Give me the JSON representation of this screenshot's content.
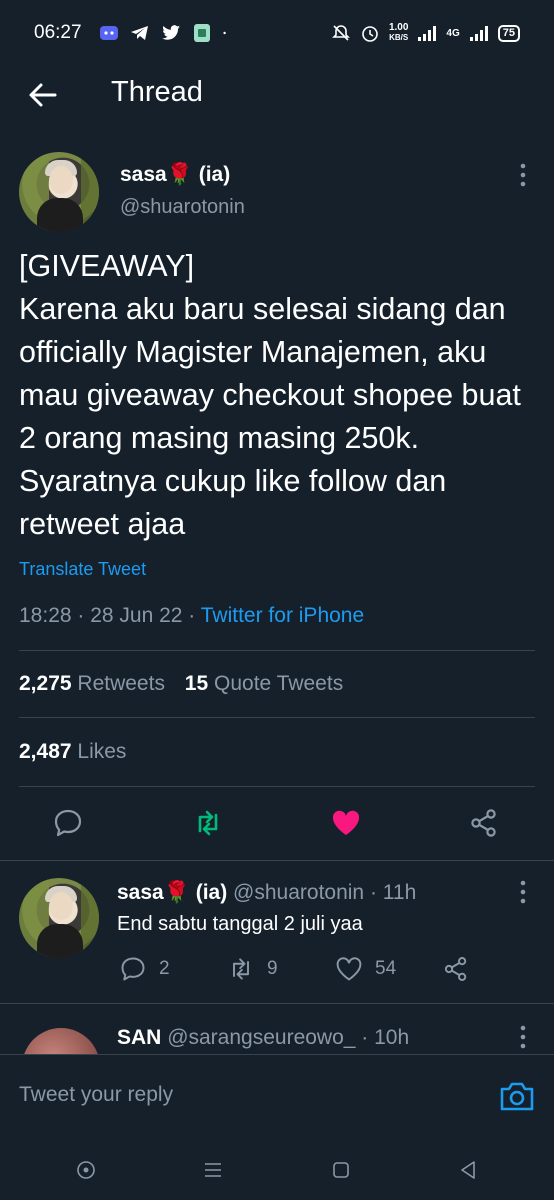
{
  "status_bar": {
    "time": "06:27",
    "speed_value": "1.00",
    "speed_unit": "KB/S",
    "network": "4G",
    "battery": "75"
  },
  "header": {
    "title": "Thread"
  },
  "main_tweet": {
    "name": "sasa🌹 (ia)",
    "handle": "@shuarotonin",
    "text": "[GIVEAWAY]\nKarena aku baru selesai sidang dan officially Magister Manajemen, aku mau giveaway checkout shopee buat 2 orang masing masing 250k. Syaratnya cukup like follow dan retweet ajaa",
    "translate_label": "Translate Tweet",
    "timestamp": "18:28 · 28 Jun 22 · ",
    "source": "Twitter for iPhone",
    "retweets_count": "2,275",
    "retweets_label": "Retweets",
    "quotes_count": "15",
    "quotes_label": "Quote Tweets",
    "likes_count": "2,487",
    "likes_label": "Likes",
    "liked": true,
    "like_color": "#f91880",
    "retweet_color": "#00ba7c"
  },
  "reply_1": {
    "name": "sasa🌹 (ia)",
    "handle": "@shuarotonin",
    "time": "· 11h",
    "text": "End sabtu tanggal 2 juli yaa",
    "replies": "2",
    "retweets": "9",
    "likes": "54"
  },
  "reply_2": {
    "name": "SAN",
    "handle": "@sarangseureowo_",
    "time": "· 10h"
  },
  "compose": {
    "placeholder": "Tweet your reply"
  },
  "colors": {
    "background": "#15202b",
    "accent": "#1d9bf0",
    "secondary_text": "#8b98a5",
    "divider": "#38444d"
  }
}
